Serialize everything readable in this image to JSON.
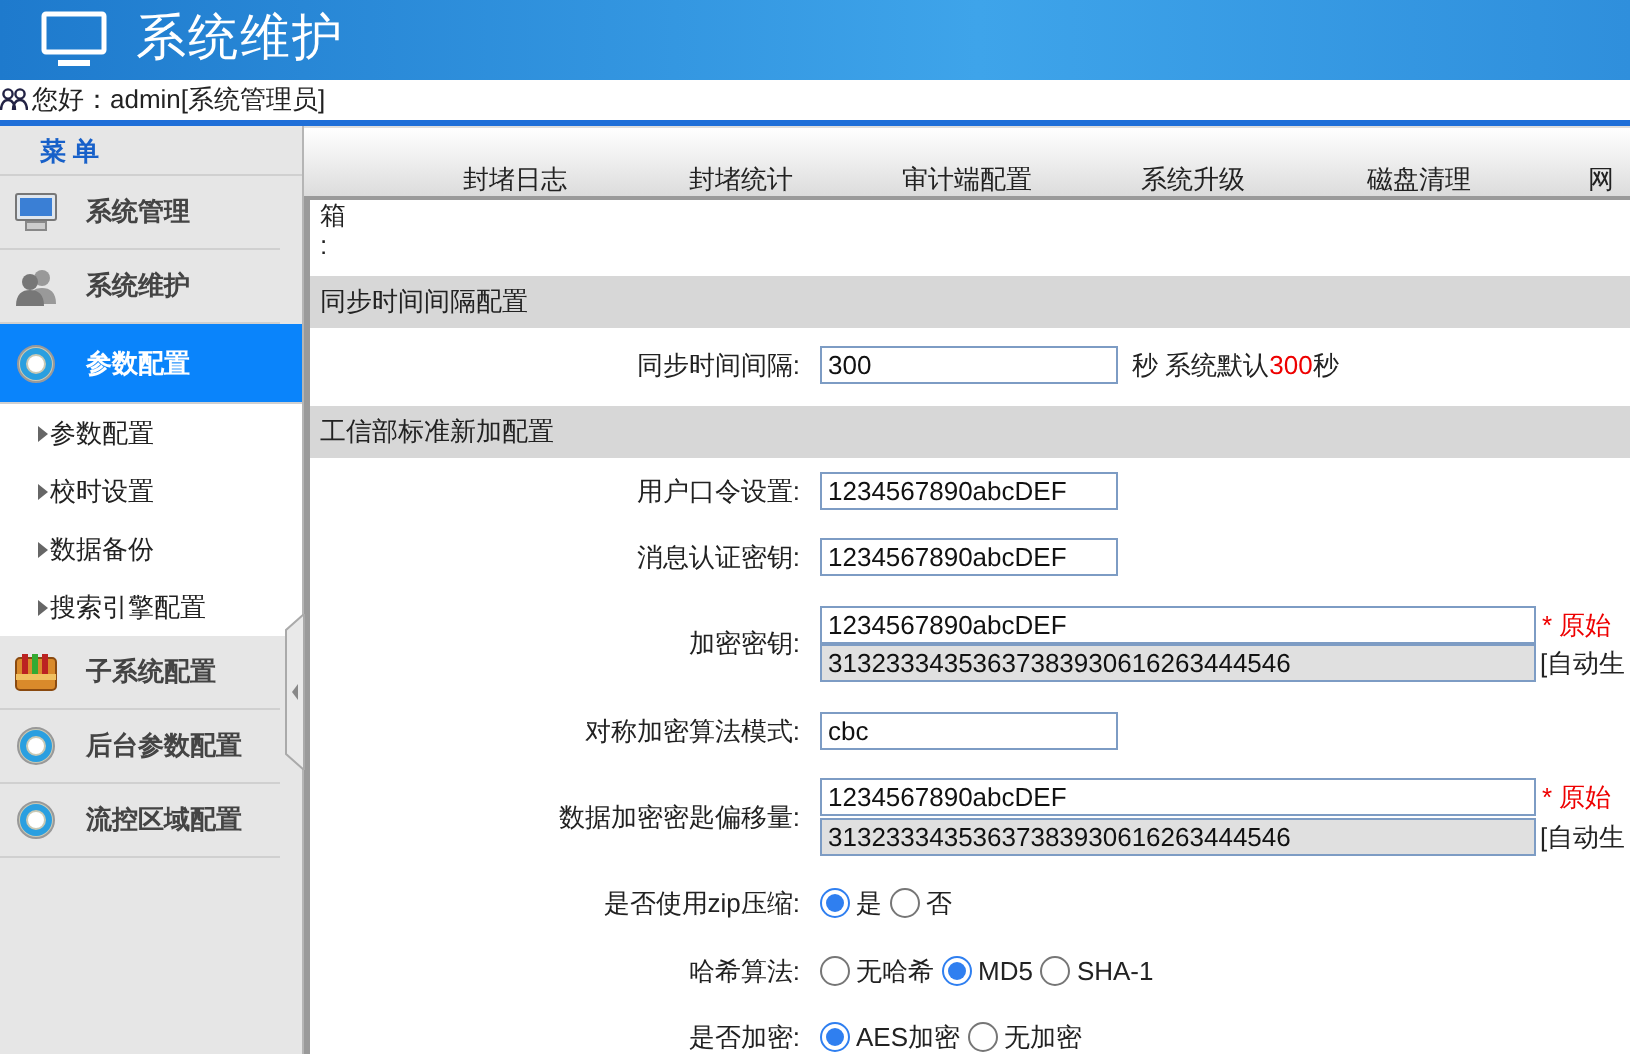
{
  "header": {
    "title": "系统维护"
  },
  "greeting": "您好：admin[系统管理员]",
  "menu": {
    "title": "菜 单",
    "items": [
      {
        "label": "系统管理",
        "kind": "monitor",
        "selected": false
      },
      {
        "label": "系统维护",
        "kind": "people",
        "selected": false
      },
      {
        "label": "参数配置",
        "kind": "ring",
        "selected": true,
        "children": [
          {
            "label": "参数配置"
          },
          {
            "label": "校时设置"
          },
          {
            "label": "数据备份"
          },
          {
            "label": "搜索引擎配置"
          }
        ]
      },
      {
        "label": "子系统配置",
        "kind": "toolbox",
        "selected": false
      },
      {
        "label": "后台参数配置",
        "kind": "ring",
        "selected": false
      },
      {
        "label": "流控区域配置",
        "kind": "ring",
        "selected": false
      }
    ]
  },
  "tabs": [
    {
      "label": "封堵日志"
    },
    {
      "label": "封堵统计"
    },
    {
      "label": "审计端配置"
    },
    {
      "label": "系统升级"
    },
    {
      "label": "磁盘清理"
    },
    {
      "label": "网"
    }
  ],
  "content": {
    "cut_label": [
      "箱",
      ":"
    ],
    "sections": [
      {
        "title": "同步时间间隔配置",
        "rows": [
          {
            "kind": "text",
            "label": "同步时间间隔:",
            "value": "300",
            "hint": "秒 系统默认",
            "hint_value": "300",
            "hint_end": "秒"
          }
        ]
      },
      {
        "title": "工信部标准新加配置",
        "rows": [
          {
            "kind": "text",
            "label": "用户口令设置:",
            "value": "1234567890abcDEF"
          },
          {
            "kind": "text",
            "label": "消息认证密钥:",
            "value": "1234567890abcDEF"
          },
          {
            "kind": "pair",
            "label": "加密密钥:",
            "value": "1234567890abcDEF",
            "note": "* 原始",
            "derived": "31323334353637383930616263444546",
            "derived_note": "[自动生"
          },
          {
            "kind": "text",
            "label": "对称加密算法模式:",
            "value": "cbc"
          },
          {
            "kind": "pair",
            "label": "数据加密密匙偏移量:",
            "value": "1234567890abcDEF",
            "note": "* 原始",
            "derived": "31323334353637383930616263444546",
            "derived_note": "[自动生"
          },
          {
            "kind": "radio",
            "label": "是否使用zip压缩:",
            "options": [
              {
                "label": "是",
                "selected": true
              },
              {
                "label": "否",
                "selected": false
              }
            ]
          },
          {
            "kind": "radio",
            "label": "哈希算法:",
            "options": [
              {
                "label": "无哈希",
                "selected": false
              },
              {
                "label": "MD5",
                "selected": true
              },
              {
                "label": "SHA-1",
                "selected": false
              }
            ]
          },
          {
            "kind": "radio",
            "label": "是否加密:",
            "options": [
              {
                "label": "AES加密",
                "selected": true
              },
              {
                "label": "无加密",
                "selected": false
              }
            ]
          }
        ]
      }
    ]
  }
}
